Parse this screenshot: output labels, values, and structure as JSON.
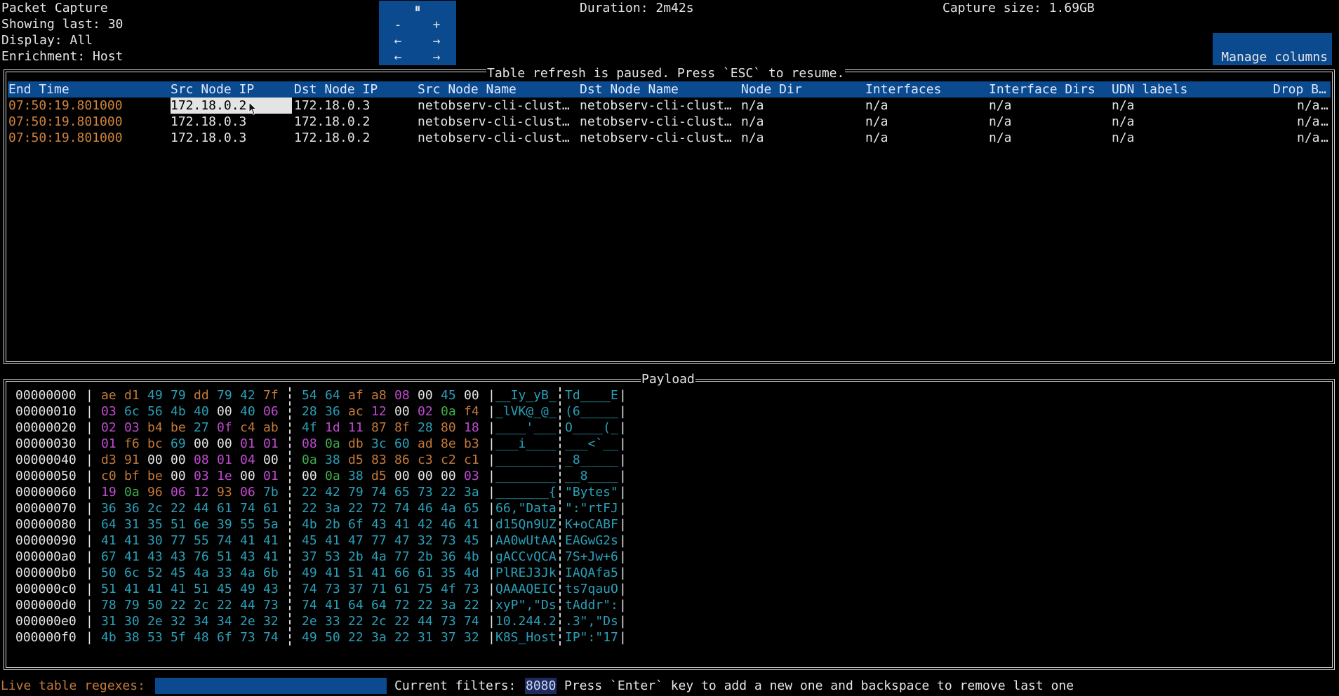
{
  "header": {
    "title": "Packet Capture",
    "showing": "Showing last: 30",
    "display": "Display: All",
    "enrichment": "Enrichment: Host",
    "duration": "Duration: 2m42s",
    "capture_size": "Capture size: 1.69GB",
    "nav": {
      "pause": "⏸",
      "minus": "-",
      "plus": "+",
      "left1": "←",
      "right1": "→",
      "left2": "←",
      "right2": "→"
    },
    "manage_columns": "Manage columns"
  },
  "table": {
    "frame_title": "Table refresh is paused. Press `ESC` to resume.",
    "columns": [
      "End Time",
      "Src Node IP",
      "Dst Node IP",
      "Src Node Name",
      "Dst Node Name",
      "Node Dir",
      "Interfaces",
      "Interface Dirs",
      "UDN labels",
      "Drop B…"
    ],
    "rows": [
      [
        "07:50:19.801000",
        "172.18.0.2",
        "172.18.0.3",
        "netobserv-cli-clust…",
        "netobserv-cli-clust…",
        "n/a",
        "n/a",
        "n/a",
        "n/a",
        "n/a",
        "…"
      ],
      [
        "07:50:19.801000",
        "172.18.0.3",
        "172.18.0.2",
        "netobserv-cli-clust…",
        "netobserv-cli-clust…",
        "n/a",
        "n/a",
        "n/a",
        "n/a",
        "n/a",
        "…"
      ],
      [
        "07:50:19.801000",
        "172.18.0.3",
        "172.18.0.2",
        "netobserv-cli-clust…",
        "netobserv-cli-clust…",
        "n/a",
        "n/a",
        "n/a",
        "n/a",
        "n/a",
        "…"
      ]
    ]
  },
  "payload": {
    "frame_title": "Payload",
    "rows": [
      {
        "offset": "00000000",
        "bytes": [
          "ae",
          "d1",
          "49",
          "79",
          "dd",
          "79",
          "42",
          "7f",
          "54",
          "64",
          "af",
          "a8",
          "08",
          "00",
          "45",
          "00"
        ],
        "ascii_left": "__Iy_yB_",
        "ascii_right": "Td____E"
      },
      {
        "offset": "00000010",
        "bytes": [
          "03",
          "6c",
          "56",
          "4b",
          "40",
          "00",
          "40",
          "06",
          "28",
          "36",
          "ac",
          "12",
          "00",
          "02",
          "0a",
          "f4"
        ],
        "ascii_left": "_lVK@_@_",
        "ascii_right": "(6_____"
      },
      {
        "offset": "00000020",
        "bytes": [
          "02",
          "03",
          "b4",
          "be",
          "27",
          "0f",
          "c4",
          "ab",
          "4f",
          "1d",
          "11",
          "87",
          "8f",
          "28",
          "80",
          "18"
        ],
        "ascii_left": "____'___",
        "ascii_right": "O____(_"
      },
      {
        "offset": "00000030",
        "bytes": [
          "01",
          "f6",
          "bc",
          "69",
          "00",
          "00",
          "01",
          "01",
          "08",
          "0a",
          "db",
          "3c",
          "60",
          "ad",
          "8e",
          "b3"
        ],
        "ascii_left": "___i____",
        "ascii_right": "___<`__"
      },
      {
        "offset": "00000040",
        "bytes": [
          "d3",
          "91",
          "00",
          "00",
          "08",
          "01",
          "04",
          "00",
          "0a",
          "38",
          "d5",
          "83",
          "86",
          "c3",
          "c2",
          "c1"
        ],
        "ascii_left": "________",
        "ascii_right": "_8_____"
      },
      {
        "offset": "00000050",
        "bytes": [
          "c0",
          "bf",
          "be",
          "00",
          "03",
          "1e",
          "00",
          "01",
          "00",
          "0a",
          "38",
          "d5",
          "00",
          "00",
          "00",
          "03"
        ],
        "ascii_left": "________",
        "ascii_right": "__8____"
      },
      {
        "offset": "00000060",
        "bytes": [
          "19",
          "0a",
          "96",
          "06",
          "12",
          "93",
          "06",
          "7b",
          "22",
          "42",
          "79",
          "74",
          "65",
          "73",
          "22",
          "3a"
        ],
        "ascii_left": "_______{",
        "ascii_right": "\"Bytes\""
      },
      {
        "offset": "00000070",
        "bytes": [
          "36",
          "36",
          "2c",
          "22",
          "44",
          "61",
          "74",
          "61",
          "22",
          "3a",
          "22",
          "72",
          "74",
          "46",
          "4a",
          "65"
        ],
        "ascii_left": "66,\"Data",
        "ascii_right": "\":\"rtFJ"
      },
      {
        "offset": "00000080",
        "bytes": [
          "64",
          "31",
          "35",
          "51",
          "6e",
          "39",
          "55",
          "5a",
          "4b",
          "2b",
          "6f",
          "43",
          "41",
          "42",
          "46",
          "41"
        ],
        "ascii_left": "d15Qn9UZ",
        "ascii_right": "K+oCABF"
      },
      {
        "offset": "00000090",
        "bytes": [
          "41",
          "41",
          "30",
          "77",
          "55",
          "74",
          "41",
          "41",
          "45",
          "41",
          "47",
          "77",
          "47",
          "32",
          "73",
          "45"
        ],
        "ascii_left": "AA0wUtAA",
        "ascii_right": "EAGwG2s"
      },
      {
        "offset": "000000a0",
        "bytes": [
          "67",
          "41",
          "43",
          "43",
          "76",
          "51",
          "43",
          "41",
          "37",
          "53",
          "2b",
          "4a",
          "77",
          "2b",
          "36",
          "4b"
        ],
        "ascii_left": "gACCvQCA",
        "ascii_right": "7S+Jw+6"
      },
      {
        "offset": "000000b0",
        "bytes": [
          "50",
          "6c",
          "52",
          "45",
          "4a",
          "33",
          "4a",
          "6b",
          "49",
          "41",
          "51",
          "41",
          "66",
          "61",
          "35",
          "4d"
        ],
        "ascii_left": "PlREJ3Jk",
        "ascii_right": "IAQAfa5"
      },
      {
        "offset": "000000c0",
        "bytes": [
          "51",
          "41",
          "41",
          "41",
          "51",
          "45",
          "49",
          "43",
          "74",
          "73",
          "37",
          "71",
          "61",
          "75",
          "4f",
          "73"
        ],
        "ascii_left": "QAAAQEIC",
        "ascii_right": "ts7qauO"
      },
      {
        "offset": "000000d0",
        "bytes": [
          "78",
          "79",
          "50",
          "22",
          "2c",
          "22",
          "44",
          "73",
          "74",
          "41",
          "64",
          "64",
          "72",
          "22",
          "3a",
          "22"
        ],
        "ascii_left": "xyP\",\"Ds",
        "ascii_right": "tAddr\":"
      },
      {
        "offset": "000000e0",
        "bytes": [
          "31",
          "30",
          "2e",
          "32",
          "34",
          "34",
          "2e",
          "32",
          "2e",
          "33",
          "22",
          "2c",
          "22",
          "44",
          "73",
          "74"
        ],
        "ascii_left": "10.244.2",
        "ascii_right": ".3\",\"Ds"
      },
      {
        "offset": "000000f0",
        "bytes": [
          "4b",
          "38",
          "53",
          "5f",
          "48",
          "6f",
          "73",
          "74",
          "49",
          "50",
          "22",
          "3a",
          "22",
          "31",
          "37",
          "32"
        ],
        "ascii_left": "K8S_Host",
        "ascii_right": "IP\":\"17"
      }
    ]
  },
  "footer": {
    "regex_label": "Live table regexes:",
    "regex_value": "",
    "current_filters_label": "Current filters:",
    "filter_value": "8080",
    "help_text": "Press `Enter` key to add a new one and backspace to remove last one"
  }
}
